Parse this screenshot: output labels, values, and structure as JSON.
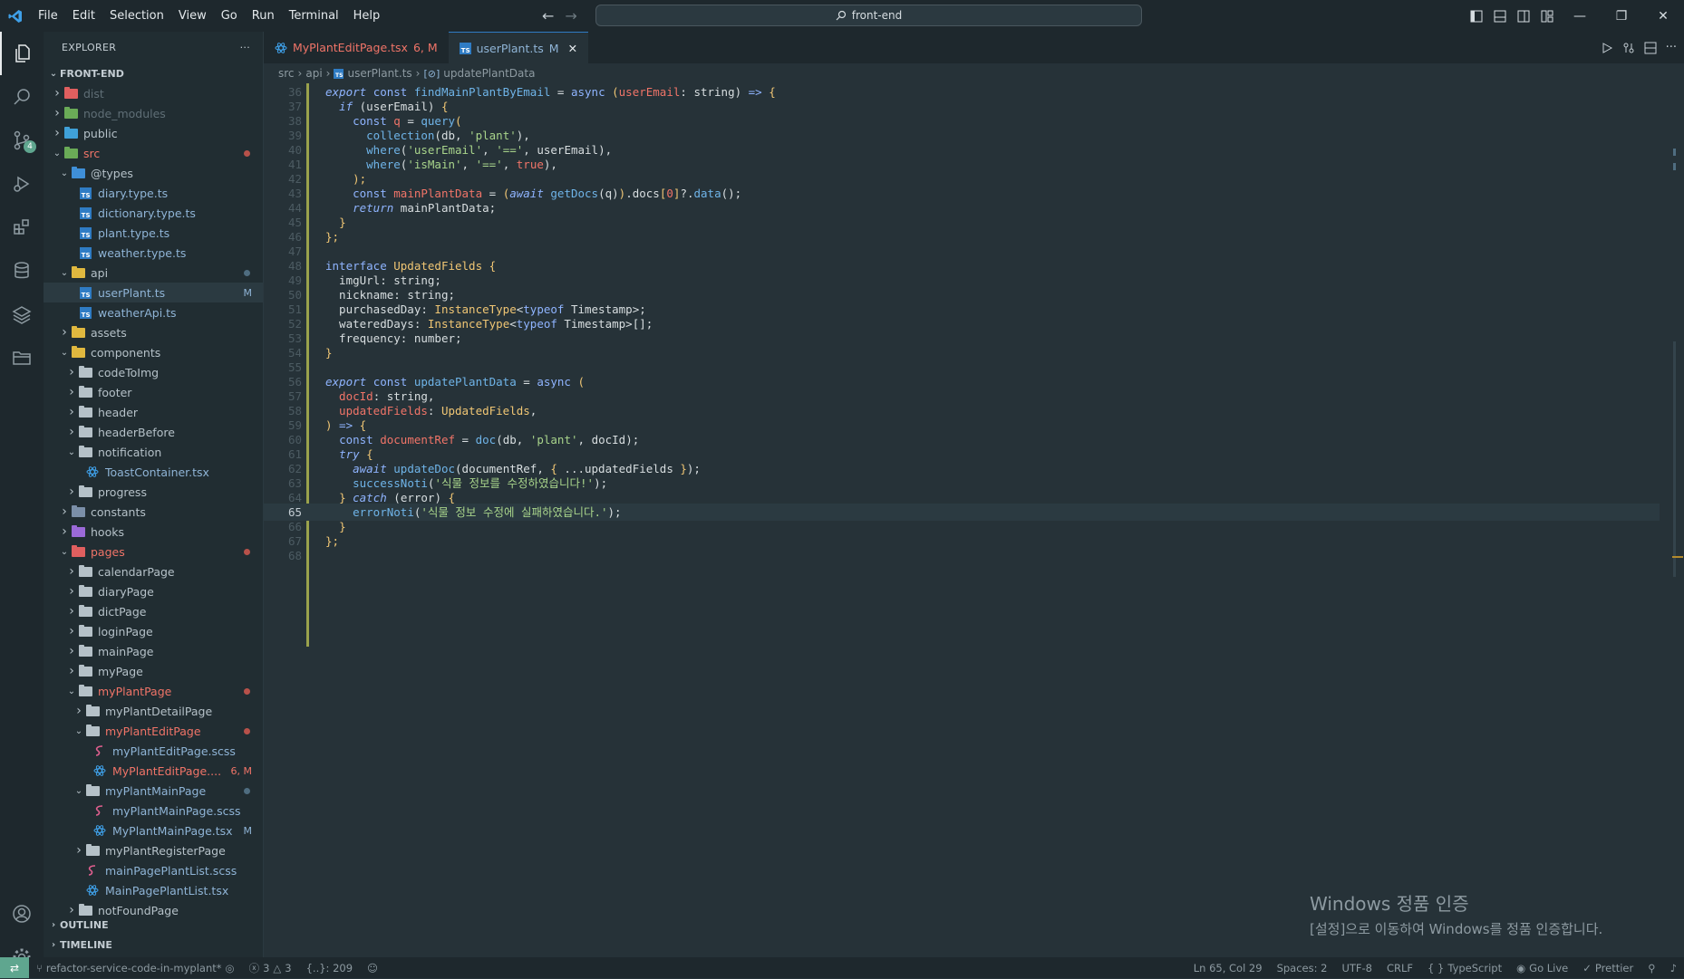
{
  "menu": [
    "File",
    "Edit",
    "Selection",
    "View",
    "Go",
    "Run",
    "Terminal",
    "Help"
  ],
  "search": {
    "text": "front-end"
  },
  "sidebar": {
    "title": "EXPLORER",
    "more": "···",
    "root": "FRONT-END",
    "outline": "OUTLINE",
    "timeline": "TIMELINE",
    "source_control_badge": "4",
    "tree": [
      {
        "label": "dist",
        "depth": 0,
        "type": "folder",
        "color": "#e05f5f",
        "muted": true
      },
      {
        "label": "node_modules",
        "depth": 0,
        "type": "folder",
        "color": "#6aab57",
        "muted": true
      },
      {
        "label": "public",
        "depth": 0,
        "type": "folder",
        "color": "#3fa0d8"
      },
      {
        "label": "src",
        "depth": 0,
        "type": "folder-open",
        "color": "#6aab57",
        "red": true,
        "dot": "red"
      },
      {
        "label": "@types",
        "depth": 1,
        "type": "folder-open",
        "color": "#3f8fd8"
      },
      {
        "label": "diary.type.ts",
        "depth": 2,
        "type": "ts"
      },
      {
        "label": "dictionary.type.ts",
        "depth": 2,
        "type": "ts"
      },
      {
        "label": "plant.type.ts",
        "depth": 2,
        "type": "ts"
      },
      {
        "label": "weather.type.ts",
        "depth": 2,
        "type": "ts"
      },
      {
        "label": "api",
        "depth": 1,
        "type": "folder-open",
        "color": "#e0b83f",
        "dot": "blue"
      },
      {
        "label": "userPlant.ts",
        "depth": 2,
        "type": "ts",
        "selected": true,
        "deco": "M"
      },
      {
        "label": "weatherApi.ts",
        "depth": 2,
        "type": "ts"
      },
      {
        "label": "assets",
        "depth": 1,
        "type": "folder",
        "color": "#e0b83f"
      },
      {
        "label": "components",
        "depth": 1,
        "type": "folder-open",
        "color": "#e0b83f"
      },
      {
        "label": "codeToImg",
        "depth": 2,
        "type": "folder",
        "color": "#b5c1c8"
      },
      {
        "label": "footer",
        "depth": 2,
        "type": "folder",
        "color": "#b5c1c8"
      },
      {
        "label": "header",
        "depth": 2,
        "type": "folder",
        "color": "#b5c1c8"
      },
      {
        "label": "headerBefore",
        "depth": 2,
        "type": "folder",
        "color": "#b5c1c8"
      },
      {
        "label": "notification",
        "depth": 2,
        "type": "folder-open",
        "color": "#b5c1c8"
      },
      {
        "label": "ToastContainer.tsx",
        "depth": 3,
        "type": "react"
      },
      {
        "label": "progress",
        "depth": 2,
        "type": "folder",
        "color": "#b5c1c8"
      },
      {
        "label": "constants",
        "depth": 1,
        "type": "folder",
        "color": "#7b8fa8"
      },
      {
        "label": "hooks",
        "depth": 1,
        "type": "folder",
        "color": "#9b6ad8"
      },
      {
        "label": "pages",
        "depth": 1,
        "type": "folder-open",
        "color": "#e05f5f",
        "red": true,
        "dot": "red"
      },
      {
        "label": "calendarPage",
        "depth": 2,
        "type": "folder",
        "color": "#b5c1c8"
      },
      {
        "label": "diaryPage",
        "depth": 2,
        "type": "folder",
        "color": "#b5c1c8"
      },
      {
        "label": "dictPage",
        "depth": 2,
        "type": "folder",
        "color": "#b5c1c8"
      },
      {
        "label": "loginPage",
        "depth": 2,
        "type": "folder",
        "color": "#b5c1c8"
      },
      {
        "label": "mainPage",
        "depth": 2,
        "type": "folder",
        "color": "#b5c1c8"
      },
      {
        "label": "myPage",
        "depth": 2,
        "type": "folder",
        "color": "#b5c1c8"
      },
      {
        "label": "myPlantPage",
        "depth": 2,
        "type": "folder-open",
        "color": "#b5c1c8",
        "red": true,
        "dot": "red"
      },
      {
        "label": "myPlantDetailPage",
        "depth": 3,
        "type": "folder",
        "color": "#b5c1c8"
      },
      {
        "label": "myPlantEditPage",
        "depth": 3,
        "type": "folder-open",
        "color": "#b5c1c8",
        "red": true,
        "dot": "red"
      },
      {
        "label": "myPlantEditPage.scss",
        "depth": 4,
        "type": "scss"
      },
      {
        "label": "MyPlantEditPage....",
        "depth": 4,
        "type": "react",
        "red": true,
        "deco": "6, M",
        "decoRed": true
      },
      {
        "label": "myPlantMainPage",
        "depth": 3,
        "type": "folder-open",
        "color": "#b5c1c8",
        "blue": true,
        "dot": "blue"
      },
      {
        "label": "myPlantMainPage.scss",
        "depth": 4,
        "type": "scss"
      },
      {
        "label": "MyPlantMainPage.tsx",
        "depth": 4,
        "type": "react",
        "blue": true,
        "deco": "M"
      },
      {
        "label": "myPlantRegisterPage",
        "depth": 3,
        "type": "folder",
        "color": "#b5c1c8"
      },
      {
        "label": "mainPagePlantList.scss",
        "depth": 3,
        "type": "scss"
      },
      {
        "label": "MainPagePlantList.tsx",
        "depth": 3,
        "type": "react"
      },
      {
        "label": "notFoundPage",
        "depth": 2,
        "type": "folder",
        "color": "#b5c1c8"
      }
    ]
  },
  "tabs": [
    {
      "label": "MyPlantEditPage.tsx",
      "suffix": "6, M",
      "active": false
    },
    {
      "label": "userPlant.ts",
      "suffix": "M",
      "active": true
    }
  ],
  "breadcrumbs": [
    "src",
    "api",
    "userPlant.ts",
    "updatePlantData"
  ],
  "editor": {
    "current_line": 65,
    "lines": [
      {
        "n": 36,
        "t": [
          [
            "export",
            "kw"
          ],
          [
            " ",
            "pn"
          ],
          [
            "const",
            "kw2"
          ],
          [
            " findMainPlantByEmail ",
            "fn"
          ],
          [
            "=",
            "pn"
          ],
          [
            " async ",
            "kw2"
          ],
          [
            "(",
            "typ"
          ],
          [
            "userEmail",
            "var"
          ],
          [
            ": string) ",
            "pn"
          ],
          [
            "=>",
            "kw2"
          ],
          [
            " {",
            "typ"
          ]
        ]
      },
      {
        "n": 37,
        "t": [
          [
            "  ",
            "pn"
          ],
          [
            "if",
            "kw"
          ],
          [
            " (userEmail) ",
            "pn"
          ],
          [
            "{",
            "typ"
          ]
        ]
      },
      {
        "n": 38,
        "t": [
          [
            "    ",
            "pn"
          ],
          [
            "const",
            "kw2"
          ],
          [
            " q ",
            "var"
          ],
          [
            "=",
            "pn"
          ],
          [
            " query",
            "fn"
          ],
          [
            "(",
            "typ"
          ]
        ]
      },
      {
        "n": 39,
        "t": [
          [
            "      ",
            "pn"
          ],
          [
            "collection",
            "fn"
          ],
          [
            "(db, ",
            "pn"
          ],
          [
            "'plant'",
            "str"
          ],
          [
            "),",
            "pn"
          ]
        ]
      },
      {
        "n": 40,
        "t": [
          [
            "      ",
            "pn"
          ],
          [
            "where",
            "fn"
          ],
          [
            "(",
            "pn"
          ],
          [
            "'userEmail'",
            "str"
          ],
          [
            ", ",
            "pn"
          ],
          [
            "'=='",
            "str"
          ],
          [
            ", userEmail),",
            "pn"
          ]
        ]
      },
      {
        "n": 41,
        "t": [
          [
            "      ",
            "pn"
          ],
          [
            "where",
            "fn"
          ],
          [
            "(",
            "pn"
          ],
          [
            "'isMain'",
            "str"
          ],
          [
            ", ",
            "pn"
          ],
          [
            "'=='",
            "str"
          ],
          [
            ", ",
            "pn"
          ],
          [
            "true",
            "num"
          ],
          [
            "),",
            "pn"
          ]
        ]
      },
      {
        "n": 42,
        "t": [
          [
            "    ",
            "pn"
          ],
          [
            ");",
            "typ"
          ]
        ]
      },
      {
        "n": 43,
        "t": [
          [
            "    ",
            "pn"
          ],
          [
            "const",
            "kw2"
          ],
          [
            " mainPlantData ",
            "var"
          ],
          [
            "= ",
            "pn"
          ],
          [
            "(",
            "typ"
          ],
          [
            "await",
            "kw"
          ],
          [
            " getDocs",
            "fn"
          ],
          [
            "(q)",
            "pn"
          ],
          [
            ")",
            "typ"
          ],
          [
            ".docs",
            "pn"
          ],
          [
            "[",
            "typ"
          ],
          [
            "0",
            "num"
          ],
          [
            "]",
            "typ"
          ],
          [
            "?.",
            "pn"
          ],
          [
            "data",
            "fn"
          ],
          [
            "();",
            "pn"
          ]
        ]
      },
      {
        "n": 44,
        "t": [
          [
            "    ",
            "pn"
          ],
          [
            "return",
            "kw"
          ],
          [
            " mainPlantData;",
            "pn"
          ]
        ]
      },
      {
        "n": 45,
        "t": [
          [
            "  ",
            "pn"
          ],
          [
            "}",
            "typ"
          ]
        ]
      },
      {
        "n": 46,
        "t": [
          [
            "};",
            "typ"
          ]
        ]
      },
      {
        "n": 47,
        "t": []
      },
      {
        "n": 48,
        "t": [
          [
            "interface",
            "kw2"
          ],
          [
            " UpdatedFields ",
            "typ"
          ],
          [
            "{",
            "typ"
          ]
        ]
      },
      {
        "n": 49,
        "t": [
          [
            "  imgUrl",
            "prop"
          ],
          [
            ": string;",
            "pn"
          ]
        ]
      },
      {
        "n": 50,
        "t": [
          [
            "  nickname",
            "prop"
          ],
          [
            ": string;",
            "pn"
          ]
        ]
      },
      {
        "n": 51,
        "t": [
          [
            "  purchasedDay",
            "prop"
          ],
          [
            ": ",
            "pn"
          ],
          [
            "InstanceType",
            "typ"
          ],
          [
            "<",
            "pn"
          ],
          [
            "typeof",
            "kw2"
          ],
          [
            " Timestamp",
            "pn"
          ],
          [
            ">;",
            "pn"
          ]
        ]
      },
      {
        "n": 52,
        "t": [
          [
            "  wateredDays",
            "prop"
          ],
          [
            ": ",
            "pn"
          ],
          [
            "InstanceType",
            "typ"
          ],
          [
            "<",
            "pn"
          ],
          [
            "typeof",
            "kw2"
          ],
          [
            " Timestamp",
            "pn"
          ],
          [
            ">[];",
            "pn"
          ]
        ]
      },
      {
        "n": 53,
        "t": [
          [
            "  frequency",
            "prop"
          ],
          [
            ": number;",
            "pn"
          ]
        ]
      },
      {
        "n": 54,
        "t": [
          [
            "}",
            "typ"
          ]
        ]
      },
      {
        "n": 55,
        "t": []
      },
      {
        "n": 56,
        "t": [
          [
            "export",
            "kw"
          ],
          [
            " ",
            "pn"
          ],
          [
            "const",
            "kw2"
          ],
          [
            " updatePlantData ",
            "fn"
          ],
          [
            "=",
            "pn"
          ],
          [
            " async ",
            "kw2"
          ],
          [
            "(",
            "typ"
          ]
        ]
      },
      {
        "n": 57,
        "t": [
          [
            "  docId",
            "var"
          ],
          [
            ": string,",
            "pn"
          ]
        ]
      },
      {
        "n": 58,
        "t": [
          [
            "  updatedFields",
            "var"
          ],
          [
            ": ",
            "pn"
          ],
          [
            "UpdatedFields",
            "typ"
          ],
          [
            ",",
            "pn"
          ]
        ]
      },
      {
        "n": 59,
        "t": [
          [
            ")",
            "typ"
          ],
          [
            " => ",
            "kw2"
          ],
          [
            "{",
            "typ"
          ]
        ]
      },
      {
        "n": 60,
        "t": [
          [
            "  ",
            "pn"
          ],
          [
            "const",
            "kw2"
          ],
          [
            " documentRef ",
            "var"
          ],
          [
            "= ",
            "pn"
          ],
          [
            "doc",
            "fn"
          ],
          [
            "(db, ",
            "pn"
          ],
          [
            "'plant'",
            "str"
          ],
          [
            ", docId);",
            "pn"
          ]
        ]
      },
      {
        "n": 61,
        "t": [
          [
            "  ",
            "pn"
          ],
          [
            "try",
            "kw"
          ],
          [
            " {",
            "typ"
          ]
        ]
      },
      {
        "n": 62,
        "t": [
          [
            "    ",
            "pn"
          ],
          [
            "await",
            "kw"
          ],
          [
            " updateDoc",
            "fn"
          ],
          [
            "(documentRef, ",
            "pn"
          ],
          [
            "{",
            "typ"
          ],
          [
            " ...updatedFields ",
            "pn"
          ],
          [
            "}",
            "typ"
          ],
          [
            ");",
            "pn"
          ]
        ]
      },
      {
        "n": 63,
        "t": [
          [
            "    ",
            "pn"
          ],
          [
            "successNoti",
            "fn"
          ],
          [
            "(",
            "pn"
          ],
          [
            "'식물 정보를 수정하였습니다!'",
            "str"
          ],
          [
            ");",
            "pn"
          ]
        ]
      },
      {
        "n": 64,
        "t": [
          [
            "  ",
            "pn"
          ],
          [
            "}",
            "typ"
          ],
          [
            " ",
            "pn"
          ],
          [
            "catch",
            "kw"
          ],
          [
            " (error) ",
            "pn"
          ],
          [
            "{",
            "typ"
          ]
        ]
      },
      {
        "n": 65,
        "t": [
          [
            "    ",
            "pn"
          ],
          [
            "errorNoti",
            "fn"
          ],
          [
            "(",
            "pn"
          ],
          [
            "'식물 정보 수정에 실패하였습니다.'",
            "str"
          ],
          [
            ");",
            "pn"
          ]
        ]
      },
      {
        "n": 66,
        "t": [
          [
            "  ",
            "pn"
          ],
          [
            "}",
            "typ"
          ]
        ]
      },
      {
        "n": 67,
        "t": [
          [
            "};",
            "typ"
          ]
        ]
      },
      {
        "n": 68,
        "t": []
      }
    ]
  },
  "watermark": {
    "line1": "Windows 정품 인증",
    "line2": "[설정]으로 이동하여 Windows를 정품 인증합니다."
  },
  "status": {
    "branch": "refactor-service-code-in-myplant*",
    "errors": "3",
    "warnings": "3",
    "selection": "{..}: 209",
    "position": "Ln 65, Col 29",
    "spaces": "Spaces: 2",
    "encoding": "UTF-8",
    "eol": "CRLF",
    "language": "TypeScript",
    "golive": "Go Live",
    "prettier": "Prettier"
  }
}
